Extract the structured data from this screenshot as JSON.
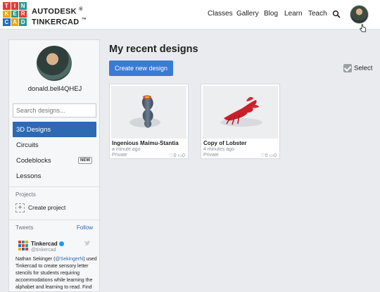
{
  "header": {
    "logo_letters": [
      "T",
      "I",
      "N",
      "K",
      "E",
      "R",
      "C",
      "A",
      "D"
    ],
    "logo_colors": [
      "#e03c31",
      "#e03c31",
      "#2a9d8f",
      "#f4a300",
      "#2a9d8f",
      "#e03c31",
      "#1f6fc0",
      "#f4a300",
      "#2a9d8f"
    ],
    "brand_line1": "AUTODESK",
    "brand_line2": "TINKERCAD",
    "brand_mark1": "®",
    "brand_mark2": "™",
    "nav": [
      "Classes",
      "Gallery",
      "Blog",
      "Learn",
      "Teach"
    ]
  },
  "sidebar": {
    "username": "donald.bell4QHEJ",
    "search_placeholder": "Search designs...",
    "menu": [
      {
        "label": "3D Designs",
        "active": true
      },
      {
        "label": "Circuits"
      },
      {
        "label": "Codeblocks",
        "badge": "NEW"
      },
      {
        "label": "Lessons"
      }
    ],
    "projects_label": "Projects",
    "create_project_label": "Create project",
    "tweets_label": "Tweets",
    "follow_label": "Follow",
    "tweet": {
      "name": "Tinkercad",
      "handle": "@tinkercad",
      "text_before": "Nathan Sekinger (",
      "mention": "@SekingerN",
      "text_after": ") used Tinkercad to create sensory letter stencils for students requiring accommodations while learning the alphabet and learning to read. Find"
    }
  },
  "main": {
    "title": "My recent designs",
    "create_button": "Create new design",
    "select_label": "Select",
    "designs": [
      {
        "title": "Ingenious Maimu-Stantia",
        "time": "a minute ago",
        "privacy": "Private",
        "likes": "0",
        "comments": "0"
      },
      {
        "title": "Copy of Lobster",
        "time": "4 minutes ago",
        "privacy": "Private",
        "likes": "0",
        "comments": "0"
      }
    ]
  },
  "colors": {
    "accent": "#2d6ab1",
    "button": "#3a7bd5",
    "background": "#e9ebee"
  }
}
